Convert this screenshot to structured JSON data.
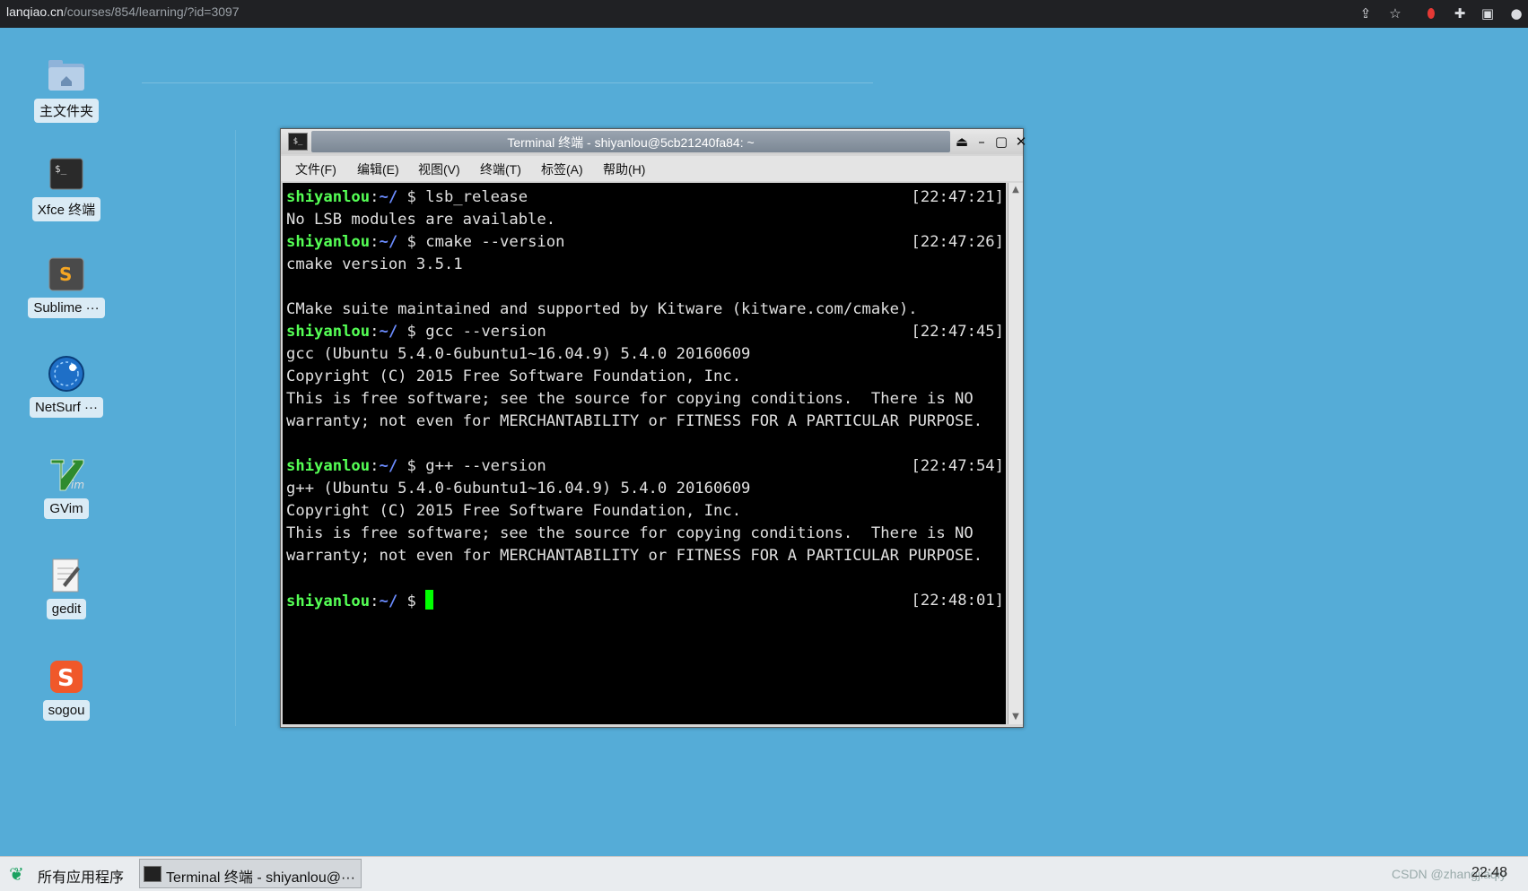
{
  "browser": {
    "url_host": "lanqiao.cn",
    "url_path": "/courses/854/learning/?id=3097",
    "icons": [
      "share-icon",
      "star-icon",
      "record-icon",
      "extensions-icon",
      "sidepanel-icon",
      "profile-icon"
    ]
  },
  "desktop": {
    "icons": [
      {
        "label": "主文件夹",
        "icon": "home-folder-icon"
      },
      {
        "label": "Xfce 终端",
        "icon": "terminal-icon"
      },
      {
        "label": "Sublime ···",
        "icon": "sublime-icon"
      },
      {
        "label": "NetSurf ···",
        "icon": "netsurf-icon"
      },
      {
        "label": "GVim",
        "icon": "gvim-icon"
      },
      {
        "label": "gedit",
        "icon": "gedit-icon"
      },
      {
        "label": "sogou",
        "icon": "sogou-icon"
      }
    ]
  },
  "terminal": {
    "title": "Terminal 终端 - shiyanlou@5cb21240fa84: ~",
    "menu": [
      "文件(F)",
      "编辑(E)",
      "视图(V)",
      "终端(T)",
      "标签(A)",
      "帮助(H)"
    ],
    "prompt_user": "shiyanlou",
    "prompt_sep": ":",
    "prompt_dir": "~/",
    "prompt_dollar": " $ ",
    "lines": [
      {
        "type": "prompt",
        "cmd": "lsb_release",
        "ts": "[22:47:21]"
      },
      {
        "type": "out",
        "text": "No LSB modules are available."
      },
      {
        "type": "prompt",
        "cmd": "cmake --version",
        "ts": "[22:47:26]"
      },
      {
        "type": "out",
        "text": "cmake version 3.5.1"
      },
      {
        "type": "out",
        "text": ""
      },
      {
        "type": "out",
        "text": "CMake suite maintained and supported by Kitware (kitware.com/cmake)."
      },
      {
        "type": "prompt",
        "cmd": "gcc --version",
        "ts": "[22:47:45]"
      },
      {
        "type": "out",
        "text": "gcc (Ubuntu 5.4.0-6ubuntu1~16.04.9) 5.4.0 20160609"
      },
      {
        "type": "out",
        "text": "Copyright (C) 2015 Free Software Foundation, Inc."
      },
      {
        "type": "out",
        "text": "This is free software; see the source for copying conditions.  There is NO"
      },
      {
        "type": "out",
        "text": "warranty; not even for MERCHANTABILITY or FITNESS FOR A PARTICULAR PURPOSE."
      },
      {
        "type": "out",
        "text": ""
      },
      {
        "type": "prompt",
        "cmd": "g++ --version",
        "ts": "[22:47:54]"
      },
      {
        "type": "out",
        "text": "g++ (Ubuntu 5.4.0-6ubuntu1~16.04.9) 5.4.0 20160609"
      },
      {
        "type": "out",
        "text": "Copyright (C) 2015 Free Software Foundation, Inc."
      },
      {
        "type": "out",
        "text": "This is free software; see the source for copying conditions.  There is NO"
      },
      {
        "type": "out",
        "text": "warranty; not even for MERCHANTABILITY or FITNESS FOR A PARTICULAR PURPOSE."
      },
      {
        "type": "out",
        "text": ""
      },
      {
        "type": "cursor",
        "cmd": "",
        "ts": "[22:48:01]"
      }
    ]
  },
  "taskbar": {
    "start_label": "所有应用程序",
    "task_label": "Terminal 终端 - shiyanlou@···",
    "clock": "22:48",
    "watermark": "CSDN @zhangjiaqiy"
  },
  "colors": {
    "desktop_bg": "#55acd7",
    "prompt_user": "#55ff55",
    "prompt_dir": "#6b8cff",
    "cursor": "#00ff00"
  }
}
